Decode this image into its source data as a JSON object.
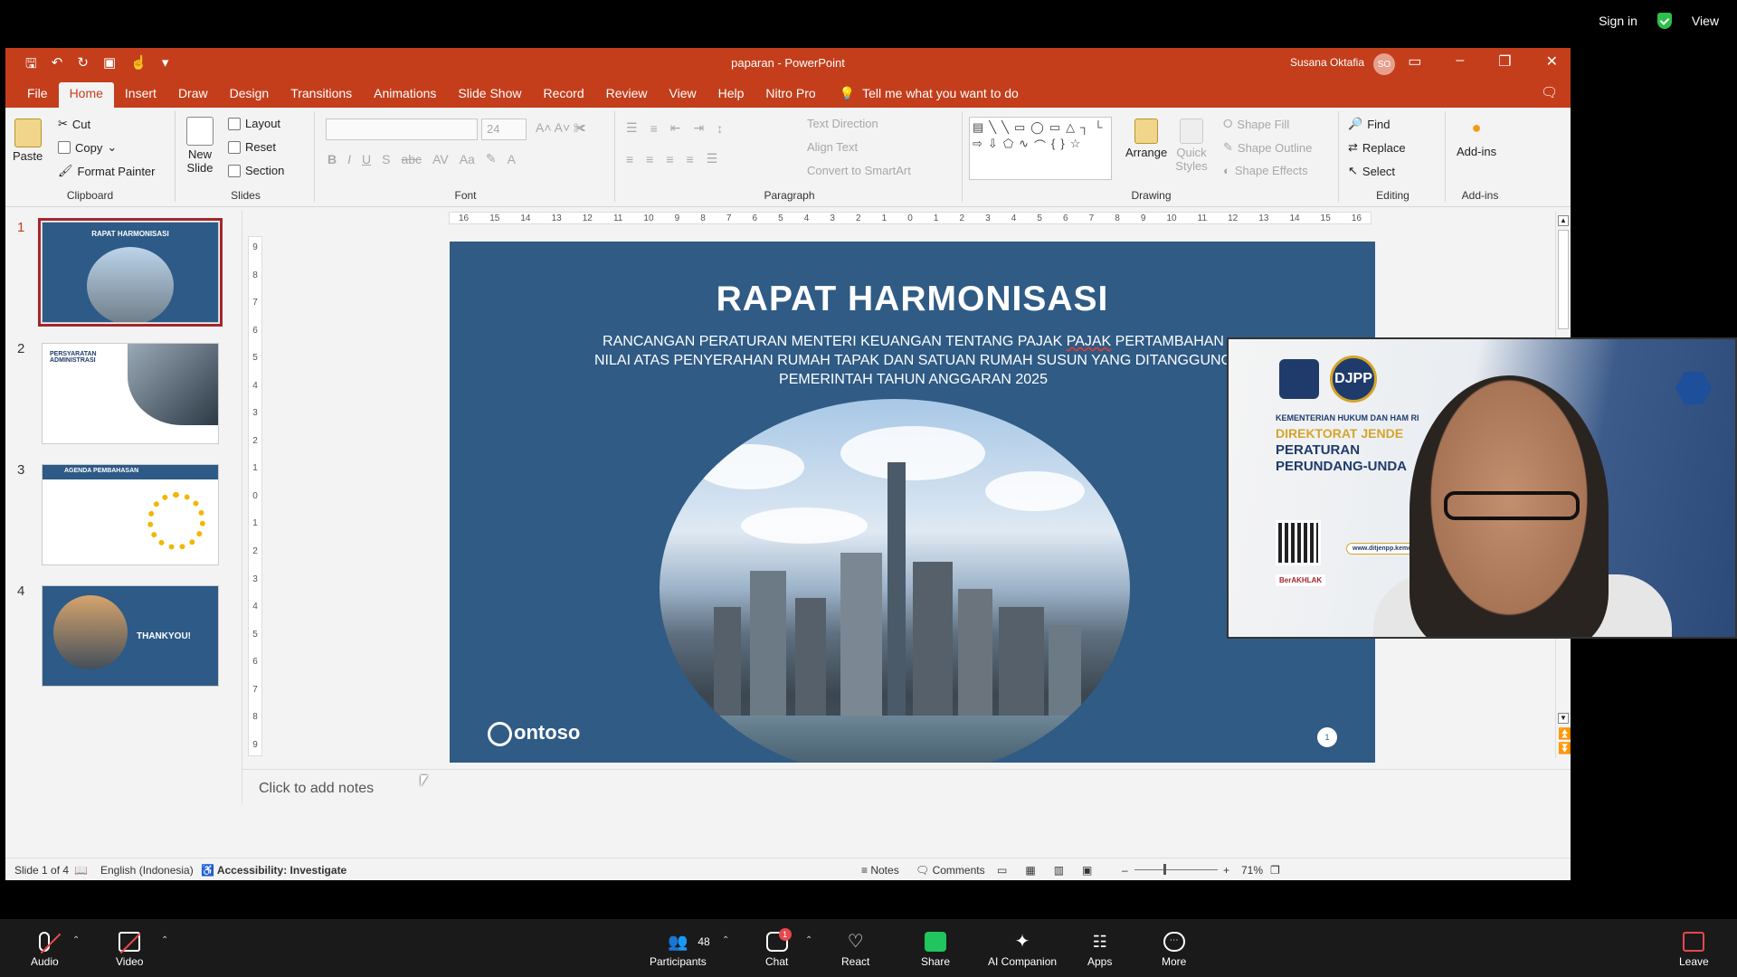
{
  "zoom_top": {
    "sign_in": "Sign in",
    "view": "View"
  },
  "window": {
    "doc_title": "paparan  -  PowerPoint",
    "user_name": "Susana Oktafia",
    "user_initials": "SO"
  },
  "tabs": [
    "File",
    "Home",
    "Insert",
    "Draw",
    "Design",
    "Transitions",
    "Animations",
    "Slide Show",
    "Record",
    "Review",
    "View",
    "Help",
    "Nitro Pro"
  ],
  "tell_me": "Tell me what you want to do",
  "ribbon": {
    "clipboard": {
      "label": "Clipboard",
      "paste": "Paste",
      "cut": "Cut",
      "copy": "Copy",
      "format_painter": "Format Painter"
    },
    "slides": {
      "label": "Slides",
      "new_slide": "New Slide",
      "layout": "Layout",
      "reset": "Reset",
      "section": "Section"
    },
    "font": {
      "label": "Font",
      "size": "24"
    },
    "paragraph": {
      "label": "Paragraph",
      "text_direction": "Text Direction",
      "align_text": "Align Text",
      "convert_smartart": "Convert to SmartArt"
    },
    "drawing": {
      "label": "Drawing",
      "arrange": "Arrange",
      "quick_styles": "Quick Styles",
      "shape_fill": "Shape Fill",
      "shape_outline": "Shape Outline",
      "shape_effects": "Shape Effects"
    },
    "editing": {
      "label": "Editing",
      "find": "Find",
      "replace": "Replace",
      "select": "Select"
    },
    "addins": {
      "label": "Add-ins",
      "addins": "Add-ins"
    }
  },
  "thumbnails": [
    {
      "num": "1",
      "title": "RAPAT HARMONISASI"
    },
    {
      "num": "2",
      "title": "PERSYARATAN ADMINISTRASI"
    },
    {
      "num": "3",
      "title": "AGENDA PEMBAHASAN"
    },
    {
      "num": "4",
      "title": "THANKYOU!"
    }
  ],
  "ruler_h": [
    "16",
    "15",
    "14",
    "13",
    "12",
    "11",
    "10",
    "9",
    "8",
    "7",
    "6",
    "5",
    "4",
    "3",
    "2",
    "1",
    "0",
    "1",
    "2",
    "3",
    "4",
    "5",
    "6",
    "7",
    "8",
    "9",
    "10",
    "11",
    "12",
    "13",
    "14",
    "15",
    "16"
  ],
  "ruler_v": [
    "9",
    "8",
    "7",
    "6",
    "5",
    "4",
    "3",
    "2",
    "1",
    "0",
    "1",
    "2",
    "3",
    "4",
    "5",
    "6",
    "7",
    "8",
    "9"
  ],
  "slide": {
    "title": "RAPAT HARMONISASI",
    "subtitle_pre": "RANCANGAN PERATURAN MENTERI KEUANGAN TENTANG PAJAK ",
    "subtitle_underlined": "PAJAK",
    "subtitle_post": " PERTAMBAHAN NILAI ATAS PENYERAHAN RUMAH TAPAK DAN SATUAN RUMAH SUSUN YANG DITANGGUNG PEMERINTAH TAHUN ANGGARAN 2025",
    "logo": "ontoso",
    "page": "1"
  },
  "notes_placeholder": "Click to add notes",
  "status": {
    "slide": "Slide 1 of 4",
    "language": "English (Indonesia)",
    "accessibility": "Accessibility: Investigate",
    "notes": "Notes",
    "comments": "Comments",
    "zoom": "71%"
  },
  "video": {
    "logo2": "DJPP",
    "line1": "KEMENTERIAN HUKUM DAN HAM RI",
    "line2": "DIREKTORAT JENDE",
    "line3": "PERATURAN",
    "line4": "PERUNDANG-UNDA",
    "url": "www.ditjenpp.kemen",
    "berakhlak": "BerAKHLAK"
  },
  "zoom_bar": {
    "audio": "Audio",
    "video": "Video",
    "participants": "Participants",
    "participants_count": "48",
    "chat": "Chat",
    "chat_badge": "1",
    "react": "React",
    "share": "Share",
    "ai": "AI Companion",
    "apps": "Apps",
    "more": "More",
    "leave": "Leave"
  }
}
